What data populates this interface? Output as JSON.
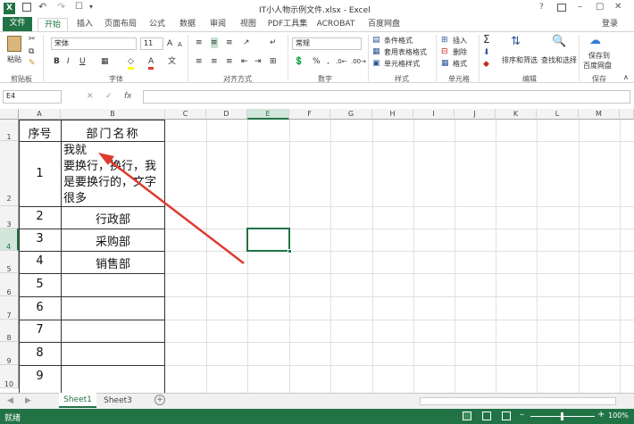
{
  "titlebar": {
    "title": "IT小人物示例文件.xlsx - Excel",
    "min": "–",
    "restore": "▢",
    "close": "✕",
    "help": "?"
  },
  "tabs": [
    "文件",
    "开始",
    "插入",
    "页面布局",
    "公式",
    "数据",
    "审阅",
    "视图",
    "PDF工具集",
    "ACROBAT",
    "百度网盘"
  ],
  "login": "登录",
  "ribbon": {
    "paste": "粘贴",
    "clipboard": "剪贴板",
    "font_name": "宋体",
    "font_size": "11",
    "font_group": "字体",
    "align_group": "对齐方式",
    "number_format": "常规",
    "number_group": "数字",
    "cond_format": "条件格式",
    "table_format": "套用表格格式",
    "cell_style": "单元格样式",
    "style_group": "样式",
    "insert": "插入",
    "delete": "删除",
    "format": "格式",
    "cells_group": "单元格",
    "sort_filter": "排序和筛选",
    "find_select": "查找和选择",
    "edit_group": "编辑",
    "save_baidu_1": "保存到",
    "save_baidu_2": "百度网盘",
    "save_group": "保存"
  },
  "formula": {
    "name_box": "E4",
    "fx": "fx",
    "value": ""
  },
  "columns": [
    "A",
    "B",
    "C",
    "D",
    "E",
    "F",
    "G",
    "H",
    "I",
    "J",
    "K",
    "L",
    "M"
  ],
  "rows": [
    "1",
    "2",
    "3",
    "4",
    "5",
    "6",
    "7",
    "8",
    "9",
    "10"
  ],
  "cells": {
    "a1": "序号",
    "b1": "部门名称",
    "a2": "1",
    "b2_l1": "我就",
    "b2_l2": "要换行，换行，我",
    "b2_l3": "是要换行的，文字",
    "b2_l4": "很多",
    "a3": "2",
    "b3": "行政部",
    "a4": "3",
    "b4": "采购部",
    "a5": "4",
    "b5": "销售部",
    "a6": "5",
    "a7": "6",
    "a8": "7",
    "a9": "8",
    "a10": "9"
  },
  "sheets": [
    "Sheet1",
    "Sheet3"
  ],
  "status": {
    "ready": "就绪",
    "zoom": "100%"
  },
  "colors": {
    "excel_green": "#217346",
    "arrow_red": "#e0392f",
    "selection": "#217346"
  }
}
